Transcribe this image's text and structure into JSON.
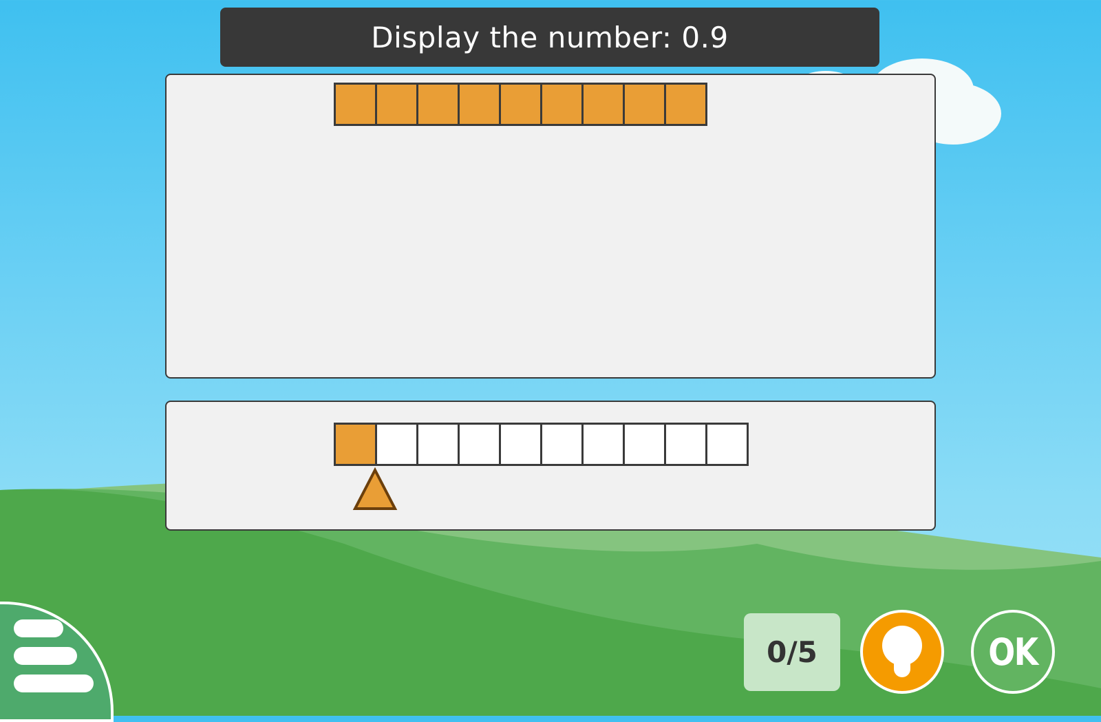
{
  "prompt": {
    "label": "Display the number:",
    "target_number": "0.9"
  },
  "display_strip": {
    "total_cells": 9,
    "filled_cells": 9
  },
  "input_strip": {
    "total_cells": 10,
    "filled_cells": 1
  },
  "score": "0/5",
  "buttons": {
    "ok_label": "OK"
  },
  "icons": {
    "menu": "menu-icon",
    "hint": "lightbulb-icon",
    "pointer": "triangle-slider-handle"
  },
  "colors": {
    "fill": "#e99e36",
    "title_bar": "#383838",
    "hint_button": "#f59b00",
    "ok_button": "#62b461",
    "menu_button": "#4eaa6c"
  }
}
